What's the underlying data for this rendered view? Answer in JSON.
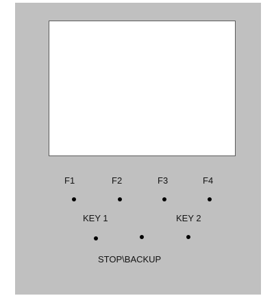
{
  "panel": {
    "function_keys": [
      "F1",
      "F2",
      "F3",
      "F4"
    ],
    "key1_label": "KEY 1",
    "key2_label": "KEY 2",
    "stop_backup_label": "STOP\\BACKUP"
  },
  "colors": {
    "panel_background": "#c0c0c0",
    "screen_background": "#ffffff",
    "button_dot": "#000000"
  }
}
